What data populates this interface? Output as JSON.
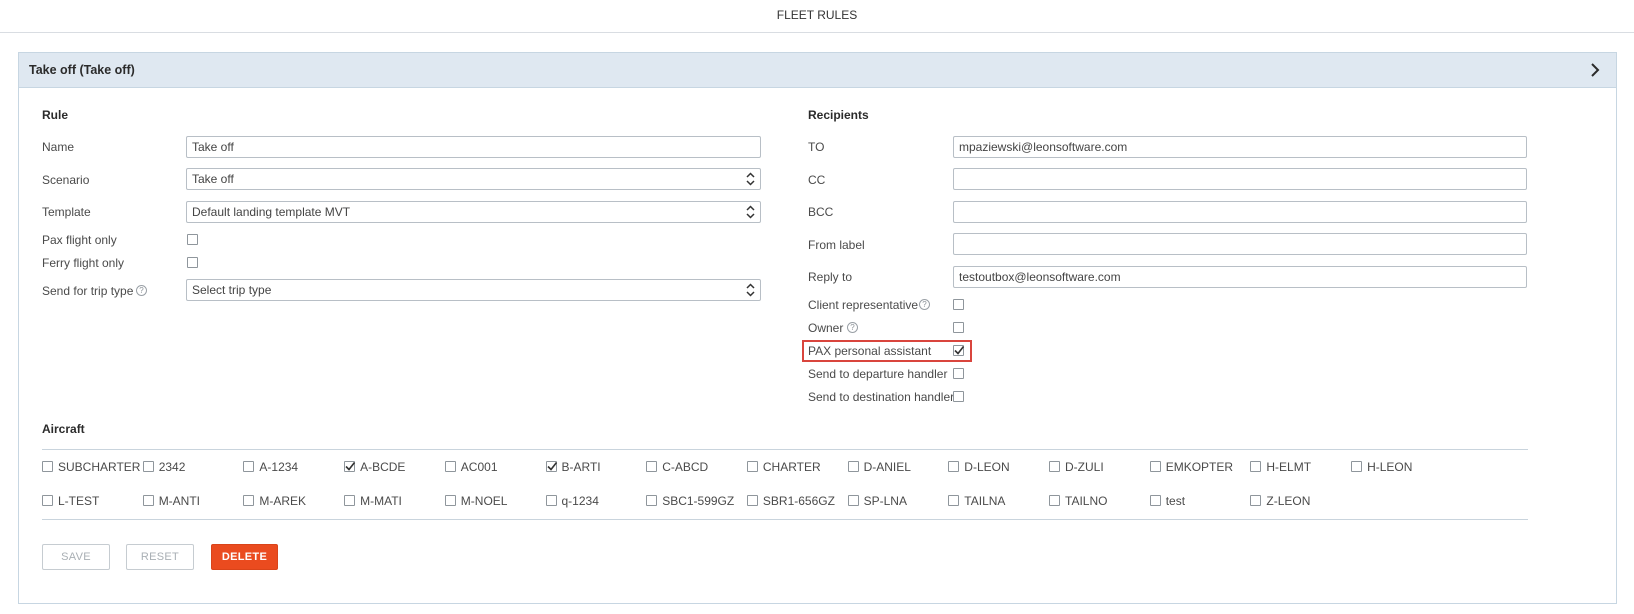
{
  "page_title": "FLEET RULES",
  "panel": {
    "title": "Take off (Take off)",
    "colors": {
      "header_bg": "#dfe8f1",
      "highlight": "#d9453d",
      "delete": "#ea4b1f"
    }
  },
  "rule": {
    "section_title": "Rule",
    "name_label": "Name",
    "name_value": "Take off",
    "scenario_label": "Scenario",
    "scenario_value": "Take off",
    "template_label": "Template",
    "template_value": "Default landing template MVT",
    "pax_flight_label": "Pax flight only",
    "pax_flight_checked": false,
    "ferry_flight_label": "Ferry flight only",
    "ferry_flight_checked": false,
    "trip_type_label": "Send for trip type",
    "trip_type_value": "Select trip type"
  },
  "recipients": {
    "section_title": "Recipients",
    "to_label": "TO",
    "to_value": "mpaziewski@leonsoftware.com",
    "cc_label": "CC",
    "cc_value": "",
    "bcc_label": "BCC",
    "bcc_value": "",
    "from_label": "From label",
    "from_value": "",
    "reply_label": "Reply to",
    "reply_value": "testoutbox@leonsoftware.com",
    "client_rep_label": "Client representative",
    "owner_label": "Owner",
    "pax_assistant_label": "PAX personal assistant",
    "departure_handler_label": "Send to departure handler",
    "destination_handler_label": "Send to destination handler"
  },
  "aircraft": {
    "section_title": "Aircraft",
    "row1": [
      {
        "label": "SUBCHARTER",
        "checked": false
      },
      {
        "label": "2342",
        "checked": false
      },
      {
        "label": "A-1234",
        "checked": false
      },
      {
        "label": "A-BCDE",
        "checked": true
      },
      {
        "label": "AC001",
        "checked": false
      },
      {
        "label": "B-ARTI",
        "checked": true
      },
      {
        "label": "C-ABCD",
        "checked": false
      },
      {
        "label": "CHARTER",
        "checked": false
      },
      {
        "label": "D-ANIEL",
        "checked": false
      },
      {
        "label": "D-LEON",
        "checked": false
      },
      {
        "label": "D-ZULI",
        "checked": false
      },
      {
        "label": "EMKOPTER",
        "checked": false
      },
      {
        "label": "H-ELMT",
        "checked": false
      },
      {
        "label": "H-LEON",
        "checked": false
      }
    ],
    "row2": [
      {
        "label": "L-TEST",
        "checked": false
      },
      {
        "label": "M-ANTI",
        "checked": false
      },
      {
        "label": "M-AREK",
        "checked": false
      },
      {
        "label": "M-MATI",
        "checked": false
      },
      {
        "label": "M-NOEL",
        "checked": false
      },
      {
        "label": "q-1234",
        "checked": false
      },
      {
        "label": "SBC1-599GZ",
        "checked": false
      },
      {
        "label": "SBR1-656GZ",
        "checked": false
      },
      {
        "label": "SP-LNA",
        "checked": false
      },
      {
        "label": "TAILNA",
        "checked": false
      },
      {
        "label": "TAILNO",
        "checked": false
      },
      {
        "label": "test",
        "checked": false
      },
      {
        "label": "Z-LEON",
        "checked": false
      }
    ]
  },
  "buttons": {
    "save": "SAVE",
    "reset": "RESET",
    "delete": "DELETE"
  }
}
